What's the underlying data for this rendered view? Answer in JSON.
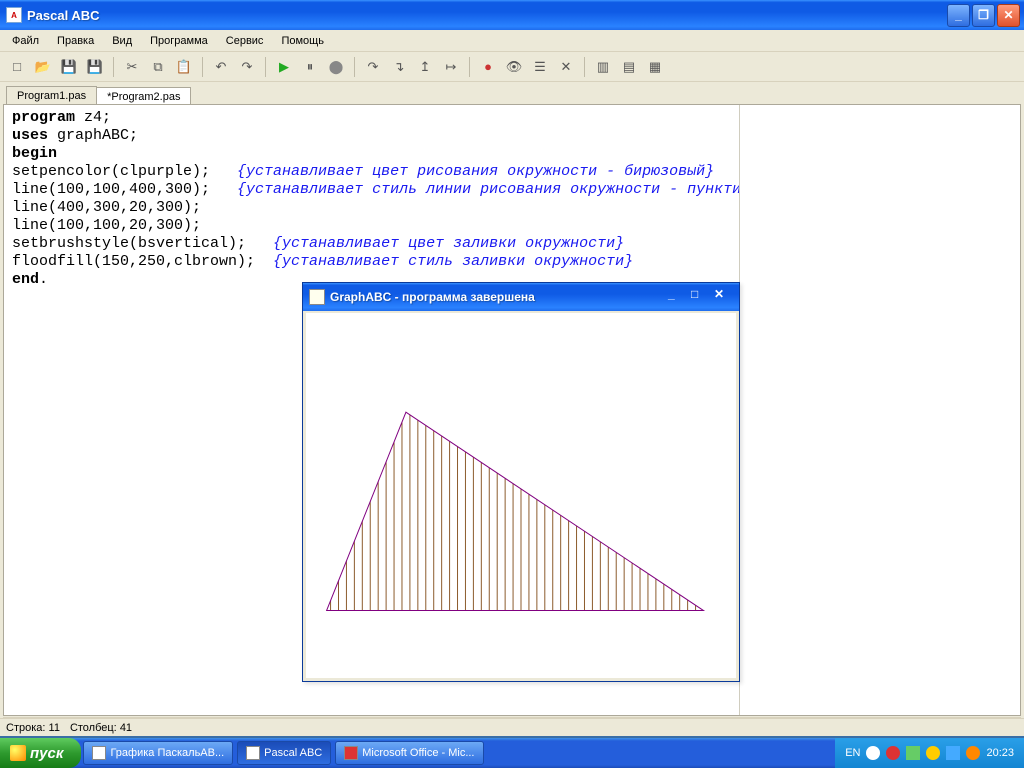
{
  "window": {
    "title": "Pascal ABC"
  },
  "menu": [
    "Файл",
    "Правка",
    "Вид",
    "Программа",
    "Сервис",
    "Помощь"
  ],
  "tabs": [
    {
      "label": "Program1.pas",
      "active": false
    },
    {
      "label": "*Program2.pas",
      "active": true
    }
  ],
  "code": {
    "l1a": "program",
    "l1b": " z4;",
    "l2a": "uses",
    "l2b": " graphABC;",
    "l3": "begin",
    "l4a": "setpencolor(clpurple);   ",
    "l4c": "{устанавливает цвет рисования окружности - бирюзовый}",
    "l5a": "line(100,100,400,300);   ",
    "l5c": "{устанавливает стиль линии рисования окружности - пунктирная линия}",
    "l6": "line(400,300,20,300);",
    "l7": "line(100,100,20,300);",
    "l8a": "setbrushstyle(bsvertical);   ",
    "l8c": "{устанавливает цвет заливки окружности}",
    "l9a": "floodfill(150,250,clbrown);  ",
    "l9c": "{устанавливает стиль заливки окружности}",
    "l10a": "end",
    "l10b": "."
  },
  "status": {
    "line_label": "Строка: ",
    "line": "11",
    "col_label": "Столбец: ",
    "col": "41"
  },
  "child": {
    "title": "GraphABC - программа завершена"
  },
  "taskbar": {
    "start": "пуск",
    "items": [
      {
        "label": "Графика ПаскальАВ...",
        "active": false
      },
      {
        "label": "Pascal ABC",
        "active": true
      },
      {
        "label": "Microsoft Office - Mic...",
        "active": false
      }
    ],
    "lang": "EN",
    "clock": "20:23"
  },
  "toolbar_icons": [
    "new-file-icon",
    "open-icon",
    "save-icon",
    "save-all-icon",
    "sep",
    "cut-icon",
    "copy-icon",
    "paste-icon",
    "sep",
    "undo-icon",
    "redo-icon",
    "sep",
    "run-icon",
    "pause-icon",
    "stop-icon",
    "sep",
    "step-over-icon",
    "step-into-icon",
    "step-out-icon",
    "run-to-cursor-icon",
    "sep",
    "toggle-breakpoint-icon",
    "watch-icon",
    "view-vars-icon",
    "clear-breakpoints-icon",
    "sep",
    "window-cascade-icon",
    "window-tile-h-icon",
    "window-tile-v-icon"
  ]
}
